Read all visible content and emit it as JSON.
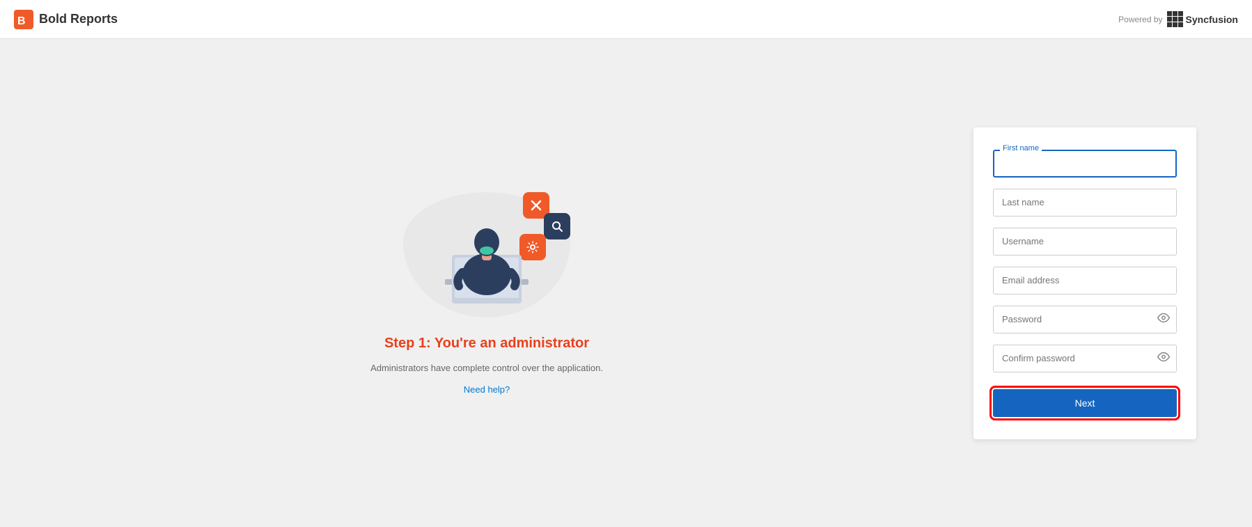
{
  "header": {
    "logo_text": "Bold Reports",
    "powered_by_text": "Powered by",
    "syncfusion_text": "Syncfusion"
  },
  "illustration": {
    "step_title": "Step 1: You're an administrator",
    "step_description": "Administrators have complete control over the application.",
    "need_help_text": "Need help?"
  },
  "form": {
    "first_name_label": "First name",
    "first_name_placeholder": "",
    "last_name_placeholder": "Last name",
    "username_placeholder": "Username",
    "email_placeholder": "Email address",
    "password_placeholder": "Password",
    "confirm_password_placeholder": "Confirm password",
    "next_button_label": "Next"
  },
  "icons": {
    "logo_icon": "🔷",
    "eye_icon": "👁",
    "float_icon_1": "✕",
    "float_icon_2": "🔍",
    "float_icon_3": "⚙"
  }
}
